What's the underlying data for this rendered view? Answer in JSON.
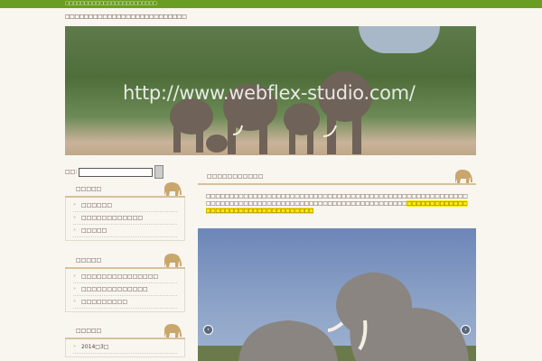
{
  "topbar": {
    "text": "□□□□□□□□□□□□□□□□□□□□□□□□"
  },
  "tagline": "□□□□□□□□□□□□□□□□□□□□□□□□□□",
  "banner": {
    "url_text": "http://www.webflex-studio.com/"
  },
  "search": {
    "label": "□□:",
    "value": "",
    "button": ""
  },
  "widgets": [
    {
      "title": "□□□□□",
      "items": [
        "□□□□□□",
        "□□□□□□□□□□□□",
        "□□□□□"
      ]
    },
    {
      "title": "□□□□□",
      "items": [
        "□□□□□□□□□□□□□□□",
        "□□□□□□□□□□□□□",
        "□□□□□□□□□"
      ]
    },
    {
      "title": "□□□□□",
      "items": [
        "2014□3□"
      ]
    }
  ],
  "main": {
    "title": "□□□□□□□□□□□",
    "para": "□□□□□□□□□□□□□□□□□□□□□□□□□□□□□□□□□□□□□□□□□□□□□□□□□□□□□□□□□□□□□□□□□□□□□□□□□□□□□□□□□□□□□□□□□□□□□□□□□□□",
    "highlight": "□□□□□□□□□□□□□□□□□□□□□□□□□□□□□□□□□□□□"
  },
  "slideshow": {
    "prev": "‹",
    "next": "›"
  },
  "colors": {
    "green": "#6a9e22",
    "tan": "#d6c19c",
    "highlight": "#ffee00"
  }
}
